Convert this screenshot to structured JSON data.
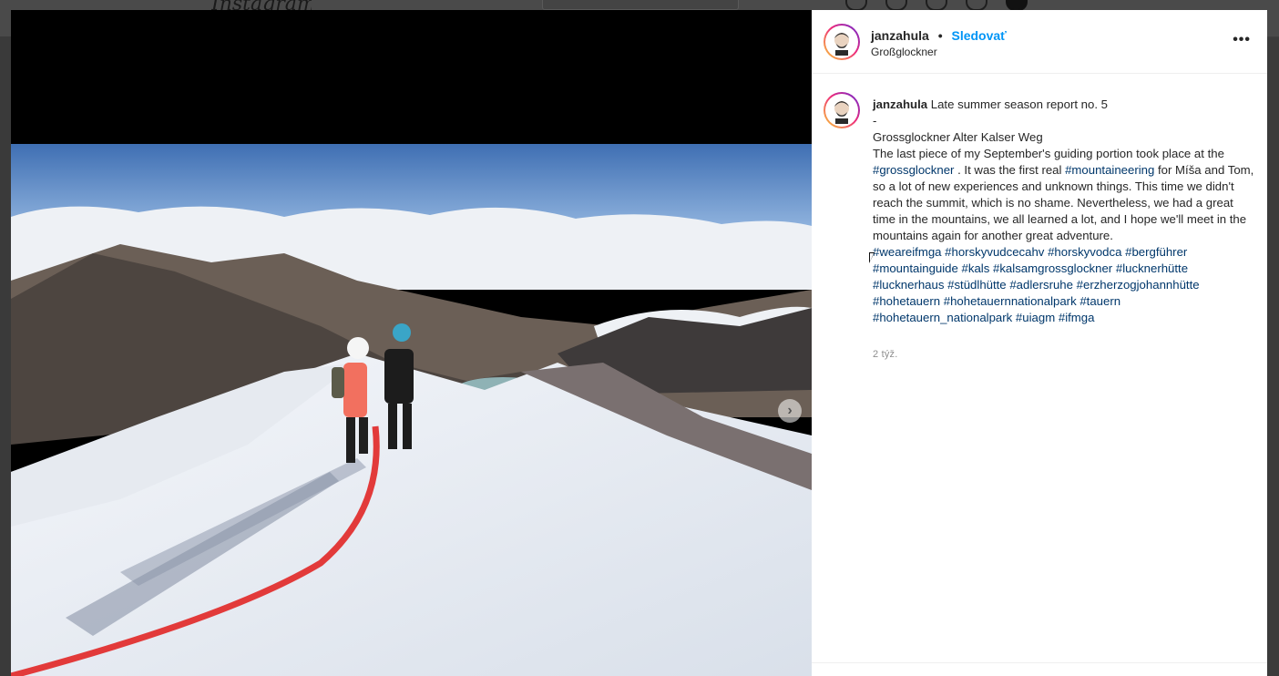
{
  "background": {
    "app_logo": "Instagram"
  },
  "post": {
    "username": "janzahula",
    "separator": "•",
    "follow_label": "Sledovať",
    "location": "Großglockner",
    "more_label": "•••",
    "next_label": "›"
  },
  "caption": {
    "username": "janzahula",
    "lines": [
      "Late summer season report no. 5",
      "-",
      "Grossglockner Alter Kalser Weg",
      "The last piece of my September's guiding portion took place at the"
    ],
    "tag_grossglockner": "#grossglockner",
    "text_a": " . It was the first real ",
    "tag_mountaineering": "#mountaineering",
    "text_b": " for Míša and Tom, so a lot of new experiences and unknown things. This time we didn't reach the summit, which is no shame. Nevertheless, we had a great time in the mountains, we all learned a lot, and I hope we'll meet in the mountains again for another great adventure.",
    "hashtags": [
      "#weareifmga",
      "#horskyvudcecahv",
      "#horskyvodca",
      "#bergführer",
      "#mountainguide",
      "#kals",
      "#kalsamgrossglockner",
      "#lucknerhütte",
      "#lucknerhaus",
      "#stüdlhütte",
      "#adlersruhe",
      "#erzherzogjohannhütte",
      "#hohetauern",
      "#hohetauernnationalpark",
      "#tauern",
      "#hohetauern_nationalpark",
      "#uiagm",
      "#ifmga"
    ],
    "time": "2 týž."
  },
  "colors": {
    "follow": "#0095f6",
    "hashtag": "#00376b",
    "text": "#262626",
    "muted": "#8e8e8e"
  }
}
